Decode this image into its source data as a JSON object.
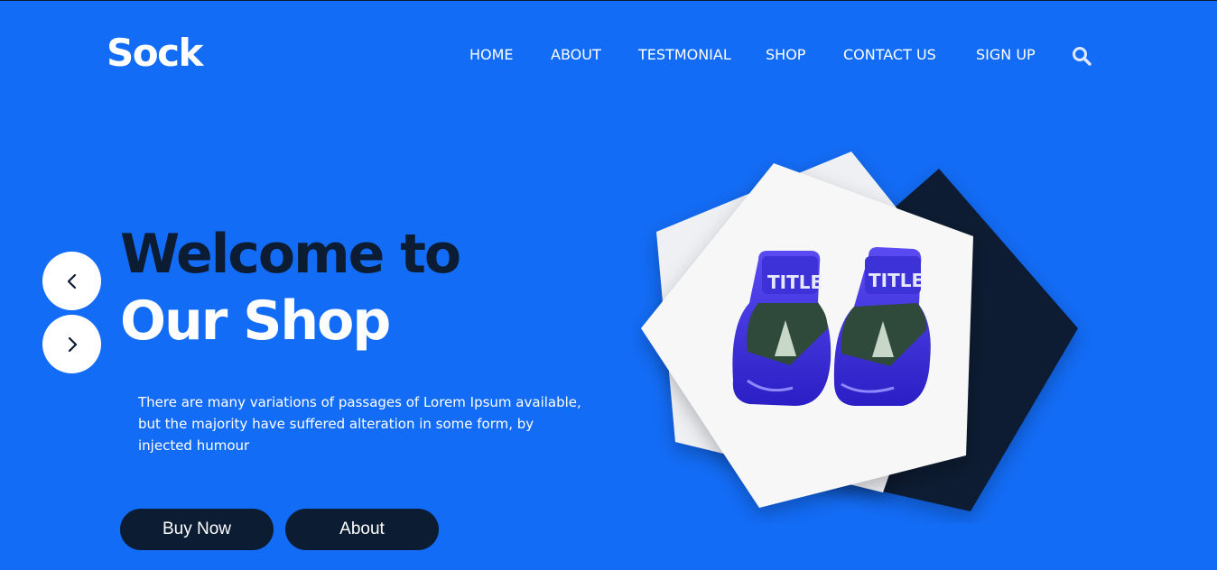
{
  "brand": {
    "logo_text": "Sock"
  },
  "nav": {
    "items": [
      "HOME",
      "ABOUT",
      "TESTMONIAL",
      "SHOP",
      "CONTACT US",
      "SIGN UP"
    ],
    "search_icon": "search-icon"
  },
  "slider": {
    "prev_icon": "chevron-left-icon",
    "next_icon": "chevron-right-icon"
  },
  "hero": {
    "title_line1": "Welcome to",
    "title_line2": "Our Shop",
    "description": "There are many variations of passages of Lorem Ipsum available, but the majority have suffered alteration in some form, by injected humour",
    "buttons": {
      "buy_label": "Buy Now",
      "about_label": "About"
    },
    "image": "boxing-gloves-image"
  },
  "colors": {
    "background": "#136cf6",
    "dark": "#0b1c33",
    "white": "#ffffff"
  }
}
